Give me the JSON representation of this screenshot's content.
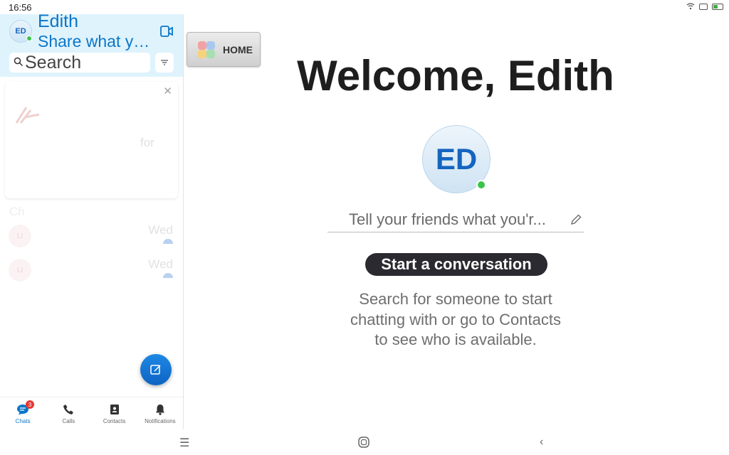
{
  "status_bar": {
    "time": "16:56"
  },
  "sidebar": {
    "user_initials": "ED",
    "user_name": "Edith",
    "user_mood": "Share what you're up to",
    "search_placeholder": "Search",
    "promo_ghost_text": "for",
    "chats_ghost_title": "Ch",
    "chat_rows": [
      {
        "initials": "LI",
        "day": "Wed"
      },
      {
        "initials": "LI",
        "day": "Wed"
      }
    ],
    "nav": [
      {
        "label": "Chats",
        "badge": "3"
      },
      {
        "label": "Calls"
      },
      {
        "label": "Contacts"
      },
      {
        "label": "Notifications"
      }
    ]
  },
  "home_button": {
    "label": "HOME"
  },
  "main": {
    "welcome": "Welcome, Edith",
    "avatar_initials": "ED",
    "mood_placeholder": "Tell your friends what you'r...",
    "start_button": "Start a conversation",
    "hint": "Search for someone to start chatting with or go to Contacts to see who is available."
  },
  "colors": {
    "accent": "#0b76c8",
    "header_bg": "#dff3fd",
    "online": "#3cc34a",
    "badge": "#e53935"
  }
}
